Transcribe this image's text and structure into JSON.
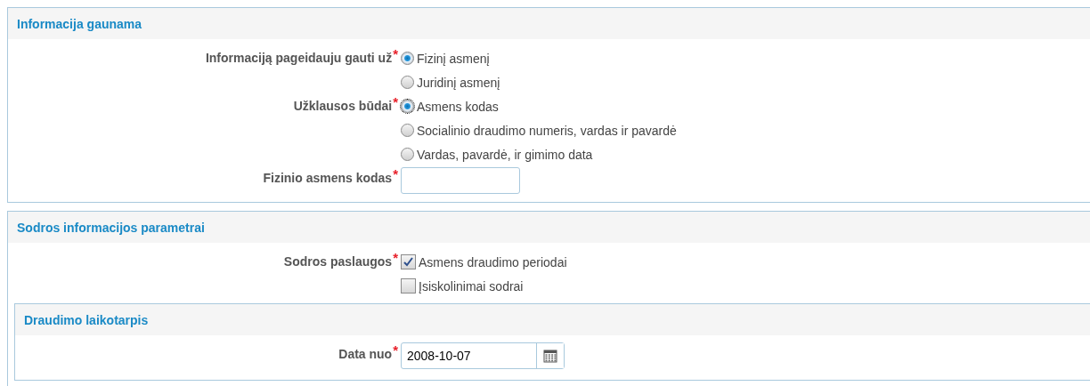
{
  "sections": [
    {
      "title": "Informacija gaunama",
      "fields": [
        {
          "kind": "radio",
          "label": "Informaciją pageidauju gauti už",
          "required_mark": "*",
          "options": [
            {
              "label": "Fizinį asmenį",
              "selected": true
            },
            {
              "label": "Juridinį asmenį",
              "selected": false
            }
          ]
        },
        {
          "kind": "radio",
          "label": "Užklausos būdai",
          "required_mark": "*",
          "focused": true,
          "options": [
            {
              "label": "Asmens kodas",
              "selected": true
            },
            {
              "label": "Socialinio draudimo numeris, vardas ir pavardė",
              "selected": false
            },
            {
              "label": "Vardas, pavardė, ir gimimo data",
              "selected": false
            }
          ]
        },
        {
          "kind": "text",
          "label": "Fizinio asmens kodas",
          "required_mark": "*"
        }
      ]
    },
    {
      "title": "Sodros informacijos parametrai",
      "fields": [
        {
          "kind": "checkbox",
          "label": "Sodros paslaugos",
          "required_mark": "*",
          "options": [
            {
              "label": "Asmens draudimo periodai",
              "checked": true
            },
            {
              "label": "Įsiskolinimai sodrai",
              "checked": false
            }
          ]
        }
      ],
      "subsections": [
        {
          "title": "Draudimo laikotarpis",
          "fields": [
            {
              "kind": "date",
              "label": "Data nuo",
              "required_mark": "*",
              "value": "2008-10-07"
            }
          ]
        }
      ]
    }
  ]
}
